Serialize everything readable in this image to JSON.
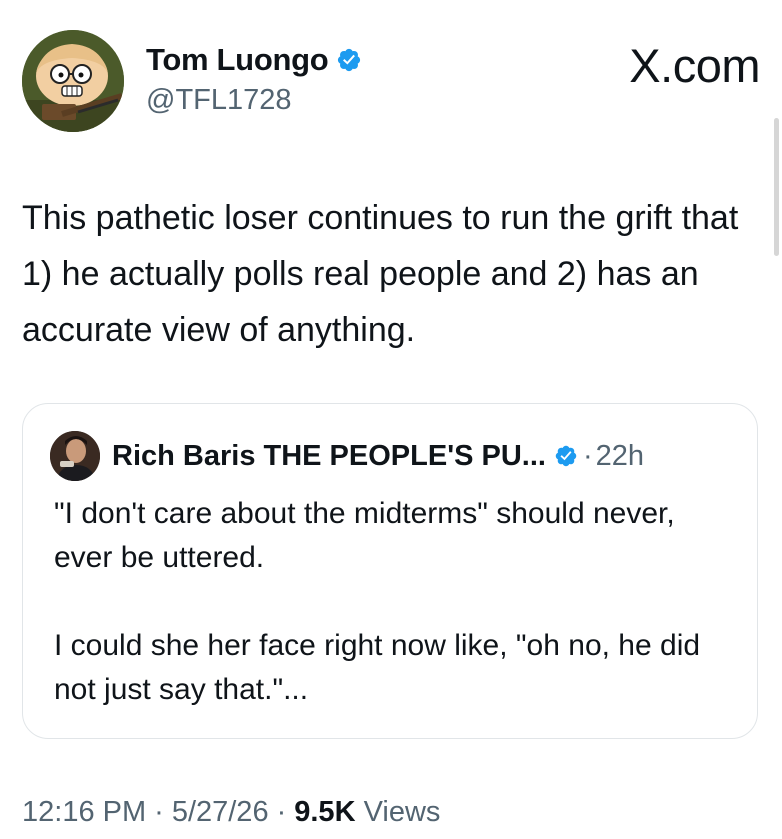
{
  "author": {
    "display_name": "Tom Luongo",
    "handle": "@TFL1728",
    "verified": true
  },
  "site_logo": "X.com",
  "tweet": {
    "text": "This pathetic loser continues to run the grift that 1) he actually polls real people and 2) has an accurate view of anything."
  },
  "quote": {
    "author_name": "Rich Baris THE PEOPLE'S PU...",
    "verified": true,
    "dot": "·",
    "time": "22h",
    "paragraph1": "\"I don't care about the midterms\" should never, ever be uttered.",
    "paragraph2": "I could she her face right now like, \"oh no, he did not just say that.\"..."
  },
  "meta": {
    "time": "12:16 PM",
    "sep": "·",
    "date": "5/27/26",
    "views_count": "9.5K",
    "views_label": "Views"
  },
  "colors": {
    "verified_blue": "#1d9bf0",
    "secondary_text": "#536471",
    "primary_text": "#0f1419",
    "card_border": "#e1e5e8"
  },
  "icons": {
    "verified": "verified-badge-icon",
    "avatar": "cartoon-avatar-icon"
  }
}
